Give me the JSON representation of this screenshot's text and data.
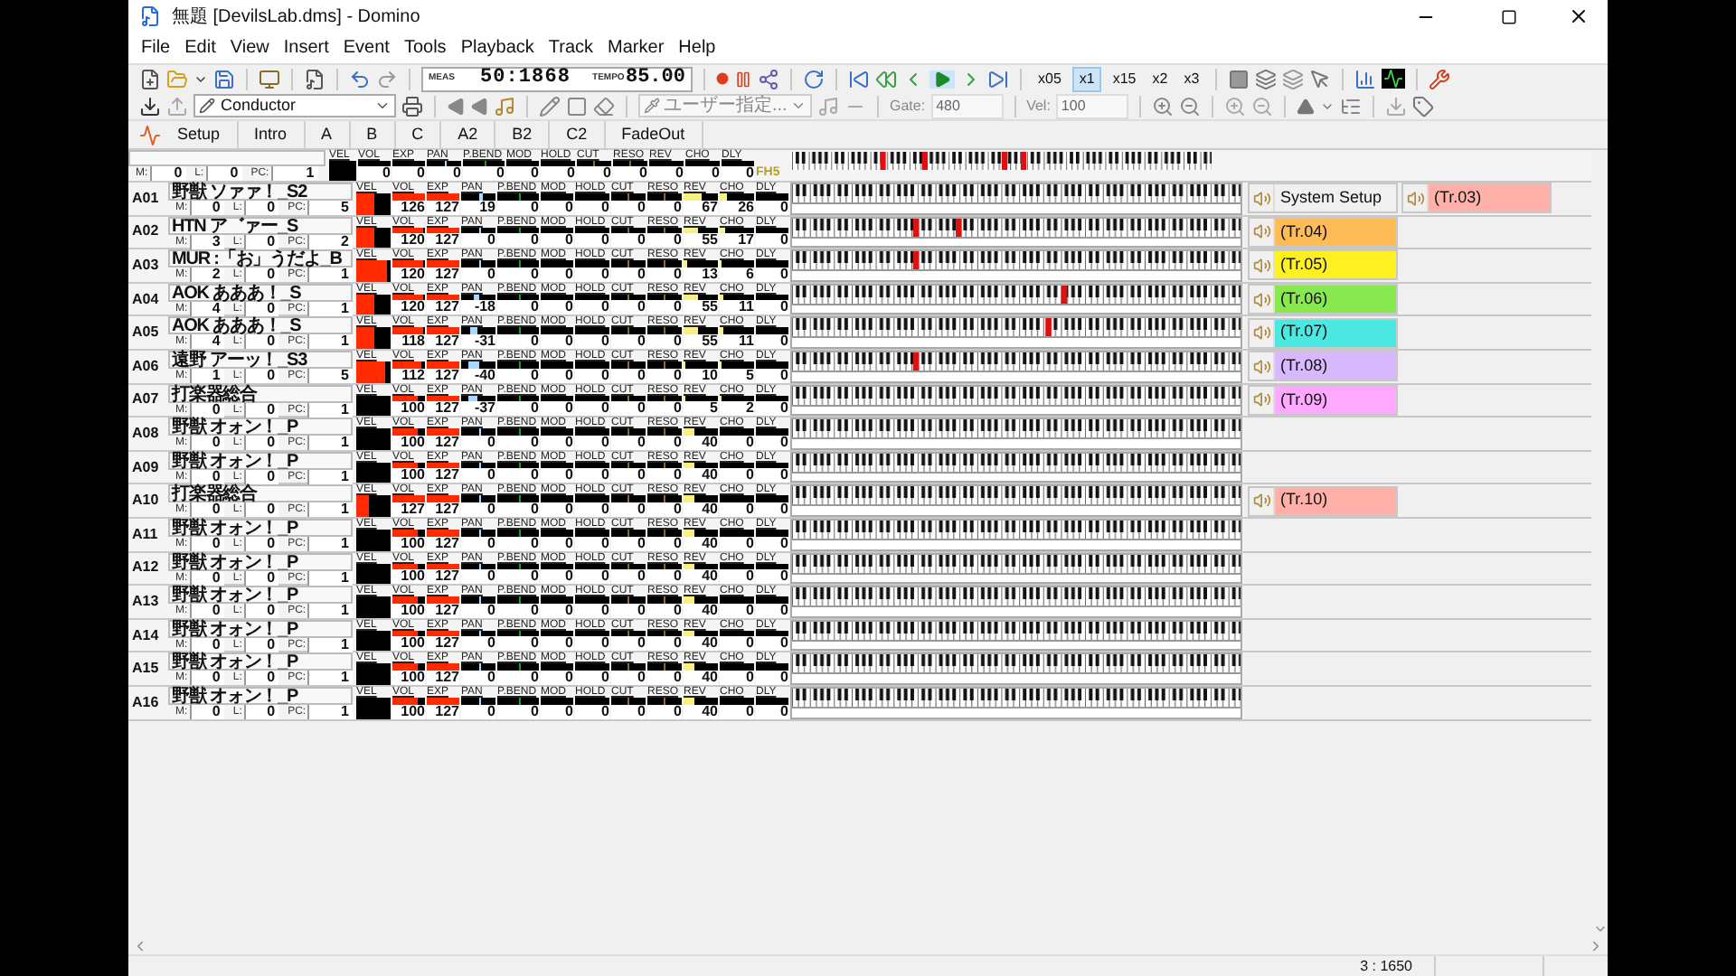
{
  "window": {
    "title": "無題 [DevilsLab.dms] - Domino"
  },
  "menu": [
    "File",
    "Edit",
    "View",
    "Insert",
    "Event",
    "Tools",
    "Playback",
    "Track",
    "Marker",
    "Help"
  ],
  "transport": {
    "meas_label": "MEAS",
    "meas": "50:1868",
    "tempo_label": "TEMPO",
    "tempo": "85.00"
  },
  "speeds": [
    {
      "label": "x05",
      "selected": false
    },
    {
      "label": "x1",
      "selected": true
    },
    {
      "label": "x15",
      "selected": false
    },
    {
      "label": "x2",
      "selected": false
    },
    {
      "label": "x3",
      "selected": false
    }
  ],
  "track_select": {
    "value": "Conductor"
  },
  "quantize_select": {
    "value": "ユーザー指定...",
    "disabled": true
  },
  "gate": {
    "label": "Gate:",
    "value": "480",
    "disabled": true
  },
  "velocity": {
    "label": "Vel:",
    "value": "100",
    "disabled": true
  },
  "markers": [
    "Setup",
    "Intro",
    "A",
    "B",
    "C",
    "A2",
    "B2",
    "C2",
    "FadeOut"
  ],
  "conductor": {
    "fields": [
      {
        "label": "M:",
        "value": "0"
      },
      {
        "label": "L:",
        "value": "0"
      },
      {
        "label": "PC:",
        "value": "1"
      }
    ],
    "velocity": {
      "label": "VEL",
      "level": 0
    },
    "controls": [
      {
        "label": "VOL",
        "value": "0"
      },
      {
        "label": "EXP",
        "value": "0"
      },
      {
        "label": "PAN",
        "value": "0"
      },
      {
        "label": "P.BEND",
        "value": "0"
      },
      {
        "label": "MOD",
        "value": "0"
      },
      {
        "label": "HOLD",
        "value": "0"
      },
      {
        "label": "CUT",
        "value": "0"
      },
      {
        "label": "RESO",
        "value": "0"
      },
      {
        "label": "REV",
        "value": "0"
      },
      {
        "label": "CHO",
        "value": "0"
      },
      {
        "label": "DLY",
        "value": "0"
      }
    ],
    "tag": "FH5",
    "pressed_keys": [
      {
        "level": 0.21
      },
      {
        "level": 0.31
      },
      {
        "level": 0.5
      },
      {
        "level": 0.545
      }
    ]
  },
  "tracks": [
    {
      "port": "A01",
      "name": "野獣 ソァァ！_S2",
      "fields": [
        {
          "label": "M:",
          "value": "0"
        },
        {
          "label": "L:",
          "value": "0"
        },
        {
          "label": "PC:",
          "value": "5"
        }
      ],
      "velocity": {
        "label": "VEL",
        "level": 0.55
      },
      "controls": [
        {
          "label": "VOL",
          "value": "126"
        },
        {
          "label": "EXP",
          "value": "127"
        },
        {
          "label": "PAN",
          "value": "19"
        },
        {
          "label": "P.BEND",
          "value": "0"
        },
        {
          "label": "MOD",
          "value": "0"
        },
        {
          "label": "HOLD",
          "value": "0"
        },
        {
          "label": "CUT",
          "value": "0"
        },
        {
          "label": "RESO",
          "value": "0"
        },
        {
          "label": "REV",
          "value": "67"
        },
        {
          "label": "CHO",
          "value": "26"
        },
        {
          "label": "DLY",
          "value": "0"
        }
      ],
      "patterns": [
        {
          "kind": "system",
          "label": "System Setup"
        },
        {
          "kind": "track",
          "label": "(Tr.03)",
          "color": "#ffb0a8"
        }
      ]
    },
    {
      "port": "A02",
      "name": "HTN ア゛ァー_S",
      "fields": [
        {
          "label": "M:",
          "value": "3"
        },
        {
          "label": "L:",
          "value": "0"
        },
        {
          "label": "PC:",
          "value": "2"
        }
      ],
      "velocity": {
        "label": "VEL",
        "level": 0.55
      },
      "controls": [
        {
          "label": "VOL",
          "value": "120"
        },
        {
          "label": "EXP",
          "value": "127"
        },
        {
          "label": "PAN",
          "value": "0"
        },
        {
          "label": "P.BEND",
          "value": "0"
        },
        {
          "label": "MOD",
          "value": "0"
        },
        {
          "label": "HOLD",
          "value": "0"
        },
        {
          "label": "CUT",
          "value": "0"
        },
        {
          "label": "RESO",
          "value": "0"
        },
        {
          "label": "REV",
          "value": "55"
        },
        {
          "label": "CHO",
          "value": "17"
        },
        {
          "label": "DLY",
          "value": "0"
        }
      ],
      "pressed_keys": [
        {
          "level": 0.27
        },
        {
          "level": 0.365
        }
      ],
      "patterns": [
        {
          "kind": "track",
          "label": "(Tr.04)",
          "color": "#ffbb55"
        }
      ]
    },
    {
      "port": "A03",
      "name": "MUR :「お」うだよ_B",
      "fields": [
        {
          "label": "M:",
          "value": "2"
        },
        {
          "label": "L:",
          "value": "0"
        },
        {
          "label": "PC:",
          "value": "1"
        }
      ],
      "velocity": {
        "label": "VEL",
        "level": 0.92
      },
      "controls": [
        {
          "label": "VOL",
          "value": "120"
        },
        {
          "label": "EXP",
          "value": "127"
        },
        {
          "label": "PAN",
          "value": "0"
        },
        {
          "label": "P.BEND",
          "value": "0"
        },
        {
          "label": "MOD",
          "value": "0"
        },
        {
          "label": "HOLD",
          "value": "0"
        },
        {
          "label": "CUT",
          "value": "0"
        },
        {
          "label": "RESO",
          "value": "0"
        },
        {
          "label": "REV",
          "value": "13"
        },
        {
          "label": "CHO",
          "value": "6"
        },
        {
          "label": "DLY",
          "value": "0"
        }
      ],
      "pressed_keys": [
        {
          "level": 0.27
        }
      ],
      "patterns": [
        {
          "kind": "track",
          "label": "(Tr.05)",
          "color": "#fff022"
        }
      ]
    },
    {
      "port": "A04",
      "name": "AOK あああ！_S",
      "fields": [
        {
          "label": "M:",
          "value": "4"
        },
        {
          "label": "L:",
          "value": "0"
        },
        {
          "label": "PC:",
          "value": "1"
        }
      ],
      "velocity": {
        "label": "VEL",
        "level": 0.55
      },
      "controls": [
        {
          "label": "VOL",
          "value": "120"
        },
        {
          "label": "EXP",
          "value": "127"
        },
        {
          "label": "PAN",
          "value": "-18"
        },
        {
          "label": "P.BEND",
          "value": "0"
        },
        {
          "label": "MOD",
          "value": "0"
        },
        {
          "label": "HOLD",
          "value": "0"
        },
        {
          "label": "CUT",
          "value": "0"
        },
        {
          "label": "RESO",
          "value": "0"
        },
        {
          "label": "REV",
          "value": "55"
        },
        {
          "label": "CHO",
          "value": "11"
        },
        {
          "label": "DLY",
          "value": "0"
        }
      ],
      "pressed_keys": [
        {
          "level": 0.6
        }
      ],
      "patterns": [
        {
          "kind": "track",
          "label": "(Tr.06)",
          "color": "#88e850"
        }
      ]
    },
    {
      "port": "A05",
      "name": "AOK あああ！_S",
      "fields": [
        {
          "label": "M:",
          "value": "4"
        },
        {
          "label": "L:",
          "value": "0"
        },
        {
          "label": "PC:",
          "value": "1"
        }
      ],
      "velocity": {
        "label": "VEL",
        "level": 0.55
      },
      "controls": [
        {
          "label": "VOL",
          "value": "118"
        },
        {
          "label": "EXP",
          "value": "127"
        },
        {
          "label": "PAN",
          "value": "-31"
        },
        {
          "label": "P.BEND",
          "value": "0"
        },
        {
          "label": "MOD",
          "value": "0"
        },
        {
          "label": "HOLD",
          "value": "0"
        },
        {
          "label": "CUT",
          "value": "0"
        },
        {
          "label": "RESO",
          "value": "0"
        },
        {
          "label": "REV",
          "value": "55"
        },
        {
          "label": "CHO",
          "value": "11"
        },
        {
          "label": "DLY",
          "value": "0"
        }
      ],
      "pressed_keys": [
        {
          "level": 0.565
        }
      ],
      "patterns": [
        {
          "kind": "track",
          "label": "(Tr.07)",
          "color": "#4ae8e0"
        }
      ]
    },
    {
      "port": "A06",
      "name": "遠野 アーッ！_S3",
      "fields": [
        {
          "label": "M:",
          "value": "1"
        },
        {
          "label": "L:",
          "value": "0"
        },
        {
          "label": "PC:",
          "value": "5"
        }
      ],
      "velocity": {
        "label": "VEL",
        "level": 0.85
      },
      "controls": [
        {
          "label": "VOL",
          "value": "112"
        },
        {
          "label": "EXP",
          "value": "127"
        },
        {
          "label": "PAN",
          "value": "-40"
        },
        {
          "label": "P.BEND",
          "value": "0"
        },
        {
          "label": "MOD",
          "value": "0"
        },
        {
          "label": "HOLD",
          "value": "0"
        },
        {
          "label": "CUT",
          "value": "0"
        },
        {
          "label": "RESO",
          "value": "0"
        },
        {
          "label": "REV",
          "value": "10"
        },
        {
          "label": "CHO",
          "value": "5"
        },
        {
          "label": "DLY",
          "value": "0"
        }
      ],
      "pressed_keys": [
        {
          "level": 0.27
        }
      ],
      "patterns": [
        {
          "kind": "track",
          "label": "(Tr.08)",
          "color": "#d8b8ff"
        }
      ]
    },
    {
      "port": "A07",
      "name": "打楽器総合",
      "fields": [
        {
          "label": "M:",
          "value": "0"
        },
        {
          "label": "L:",
          "value": "0"
        },
        {
          "label": "PC:",
          "value": "1"
        }
      ],
      "velocity": {
        "label": "VEL",
        "level": 0
      },
      "controls": [
        {
          "label": "VOL",
          "value": "100"
        },
        {
          "label": "EXP",
          "value": "127"
        },
        {
          "label": "PAN",
          "value": "-37"
        },
        {
          "label": "P.BEND",
          "value": "0"
        },
        {
          "label": "MOD",
          "value": "0"
        },
        {
          "label": "HOLD",
          "value": "0"
        },
        {
          "label": "CUT",
          "value": "0"
        },
        {
          "label": "RESO",
          "value": "0"
        },
        {
          "label": "REV",
          "value": "5"
        },
        {
          "label": "CHO",
          "value": "2"
        },
        {
          "label": "DLY",
          "value": "0"
        }
      ],
      "patterns": [
        {
          "kind": "track",
          "label": "(Tr.09)",
          "color": "#ffa8ff"
        }
      ]
    },
    {
      "port": "A08",
      "name": "野獣 オォン！_P",
      "fields": [
        {
          "label": "M:",
          "value": "0"
        },
        {
          "label": "L:",
          "value": "0"
        },
        {
          "label": "PC:",
          "value": "1"
        }
      ],
      "velocity": {
        "label": "VEL",
        "level": 0
      },
      "controls": [
        {
          "label": "VOL",
          "value": "100"
        },
        {
          "label": "EXP",
          "value": "127"
        },
        {
          "label": "PAN",
          "value": "0"
        },
        {
          "label": "P.BEND",
          "value": "0"
        },
        {
          "label": "MOD",
          "value": "0"
        },
        {
          "label": "HOLD",
          "value": "0"
        },
        {
          "label": "CUT",
          "value": "0"
        },
        {
          "label": "RESO",
          "value": "0"
        },
        {
          "label": "REV",
          "value": "40"
        },
        {
          "label": "CHO",
          "value": "0"
        },
        {
          "label": "DLY",
          "value": "0"
        }
      ]
    },
    {
      "port": "A09",
      "name": "野獣 オォン！_P",
      "fields": [
        {
          "label": "M:",
          "value": "0"
        },
        {
          "label": "L:",
          "value": "0"
        },
        {
          "label": "PC:",
          "value": "1"
        }
      ],
      "velocity": {
        "label": "VEL",
        "level": 0
      },
      "controls": [
        {
          "label": "VOL",
          "value": "100"
        },
        {
          "label": "EXP",
          "value": "127"
        },
        {
          "label": "PAN",
          "value": "0"
        },
        {
          "label": "P.BEND",
          "value": "0"
        },
        {
          "label": "MOD",
          "value": "0"
        },
        {
          "label": "HOLD",
          "value": "0"
        },
        {
          "label": "CUT",
          "value": "0"
        },
        {
          "label": "RESO",
          "value": "0"
        },
        {
          "label": "REV",
          "value": "40"
        },
        {
          "label": "CHO",
          "value": "0"
        },
        {
          "label": "DLY",
          "value": "0"
        }
      ]
    },
    {
      "port": "A10",
      "name": "打楽器総合",
      "fields": [
        {
          "label": "M:",
          "value": "0"
        },
        {
          "label": "L:",
          "value": "0"
        },
        {
          "label": "PC:",
          "value": "1"
        }
      ],
      "velocity": {
        "label": "VEL",
        "level": 0.35
      },
      "controls": [
        {
          "label": "VOL",
          "value": "127"
        },
        {
          "label": "EXP",
          "value": "127"
        },
        {
          "label": "PAN",
          "value": "0"
        },
        {
          "label": "P.BEND",
          "value": "0"
        },
        {
          "label": "MOD",
          "value": "0"
        },
        {
          "label": "HOLD",
          "value": "0"
        },
        {
          "label": "CUT",
          "value": "0"
        },
        {
          "label": "RESO",
          "value": "0"
        },
        {
          "label": "REV",
          "value": "40"
        },
        {
          "label": "CHO",
          "value": "0"
        },
        {
          "label": "DLY",
          "value": "0"
        }
      ],
      "patterns": [
        {
          "kind": "track",
          "label": "(Tr.10)",
          "color": "#ffb0a8"
        }
      ]
    },
    {
      "port": "A11",
      "name": "野獣 オォン！_P",
      "fields": [
        {
          "label": "M:",
          "value": "0"
        },
        {
          "label": "L:",
          "value": "0"
        },
        {
          "label": "PC:",
          "value": "1"
        }
      ],
      "velocity": {
        "label": "VEL",
        "level": 0
      },
      "controls": [
        {
          "label": "VOL",
          "value": "100"
        },
        {
          "label": "EXP",
          "value": "127"
        },
        {
          "label": "PAN",
          "value": "0"
        },
        {
          "label": "P.BEND",
          "value": "0"
        },
        {
          "label": "MOD",
          "value": "0"
        },
        {
          "label": "HOLD",
          "value": "0"
        },
        {
          "label": "CUT",
          "value": "0"
        },
        {
          "label": "RESO",
          "value": "0"
        },
        {
          "label": "REV",
          "value": "40"
        },
        {
          "label": "CHO",
          "value": "0"
        },
        {
          "label": "DLY",
          "value": "0"
        }
      ]
    },
    {
      "port": "A12",
      "name": "野獣 オォン！_P",
      "fields": [
        {
          "label": "M:",
          "value": "0"
        },
        {
          "label": "L:",
          "value": "0"
        },
        {
          "label": "PC:",
          "value": "1"
        }
      ],
      "velocity": {
        "label": "VEL",
        "level": 0
      },
      "controls": [
        {
          "label": "VOL",
          "value": "100"
        },
        {
          "label": "EXP",
          "value": "127"
        },
        {
          "label": "PAN",
          "value": "0"
        },
        {
          "label": "P.BEND",
          "value": "0"
        },
        {
          "label": "MOD",
          "value": "0"
        },
        {
          "label": "HOLD",
          "value": "0"
        },
        {
          "label": "CUT",
          "value": "0"
        },
        {
          "label": "RESO",
          "value": "0"
        },
        {
          "label": "REV",
          "value": "40"
        },
        {
          "label": "CHO",
          "value": "0"
        },
        {
          "label": "DLY",
          "value": "0"
        }
      ]
    },
    {
      "port": "A13",
      "name": "野獣 オォン！_P",
      "fields": [
        {
          "label": "M:",
          "value": "0"
        },
        {
          "label": "L:",
          "value": "0"
        },
        {
          "label": "PC:",
          "value": "1"
        }
      ],
      "velocity": {
        "label": "VEL",
        "level": 0
      },
      "controls": [
        {
          "label": "VOL",
          "value": "100"
        },
        {
          "label": "EXP",
          "value": "127"
        },
        {
          "label": "PAN",
          "value": "0"
        },
        {
          "label": "P.BEND",
          "value": "0"
        },
        {
          "label": "MOD",
          "value": "0"
        },
        {
          "label": "HOLD",
          "value": "0"
        },
        {
          "label": "CUT",
          "value": "0"
        },
        {
          "label": "RESO",
          "value": "0"
        },
        {
          "label": "REV",
          "value": "40"
        },
        {
          "label": "CHO",
          "value": "0"
        },
        {
          "label": "DLY",
          "value": "0"
        }
      ]
    },
    {
      "port": "A14",
      "name": "野獣 オォン！_P",
      "fields": [
        {
          "label": "M:",
          "value": "0"
        },
        {
          "label": "L:",
          "value": "0"
        },
        {
          "label": "PC:",
          "value": "1"
        }
      ],
      "velocity": {
        "label": "VEL",
        "level": 0
      },
      "controls": [
        {
          "label": "VOL",
          "value": "100"
        },
        {
          "label": "EXP",
          "value": "127"
        },
        {
          "label": "PAN",
          "value": "0"
        },
        {
          "label": "P.BEND",
          "value": "0"
        },
        {
          "label": "MOD",
          "value": "0"
        },
        {
          "label": "HOLD",
          "value": "0"
        },
        {
          "label": "CUT",
          "value": "0"
        },
        {
          "label": "RESO",
          "value": "0"
        },
        {
          "label": "REV",
          "value": "40"
        },
        {
          "label": "CHO",
          "value": "0"
        },
        {
          "label": "DLY",
          "value": "0"
        }
      ]
    },
    {
      "port": "A15",
      "name": "野獣 オォン！_P",
      "fields": [
        {
          "label": "M:",
          "value": "0"
        },
        {
          "label": "L:",
          "value": "0"
        },
        {
          "label": "PC:",
          "value": "1"
        }
      ],
      "velocity": {
        "label": "VEL",
        "level": 0
      },
      "controls": [
        {
          "label": "VOL",
          "value": "100"
        },
        {
          "label": "EXP",
          "value": "127"
        },
        {
          "label": "PAN",
          "value": "0"
        },
        {
          "label": "P.BEND",
          "value": "0"
        },
        {
          "label": "MOD",
          "value": "0"
        },
        {
          "label": "HOLD",
          "value": "0"
        },
        {
          "label": "CUT",
          "value": "0"
        },
        {
          "label": "RESO",
          "value": "0"
        },
        {
          "label": "REV",
          "value": "40"
        },
        {
          "label": "CHO",
          "value": "0"
        },
        {
          "label": "DLY",
          "value": "0"
        }
      ]
    },
    {
      "port": "A16",
      "name": "野獣 オォン！_P",
      "fields": [
        {
          "label": "M:",
          "value": "0"
        },
        {
          "label": "L:",
          "value": "0"
        },
        {
          "label": "PC:",
          "value": "1"
        }
      ],
      "velocity": {
        "label": "VEL",
        "level": 0
      },
      "controls": [
        {
          "label": "VOL",
          "value": "100"
        },
        {
          "label": "EXP",
          "value": "127"
        },
        {
          "label": "PAN",
          "value": "0"
        },
        {
          "label": "P.BEND",
          "value": "0"
        },
        {
          "label": "MOD",
          "value": "0"
        },
        {
          "label": "HOLD",
          "value": "0"
        },
        {
          "label": "CUT",
          "value": "0"
        },
        {
          "label": "RESO",
          "value": "0"
        },
        {
          "label": "REV",
          "value": "40"
        },
        {
          "label": "CHO",
          "value": "0"
        },
        {
          "label": "DLY",
          "value": "0"
        }
      ]
    }
  ],
  "status_bar": {
    "position": "3 : 1650"
  }
}
